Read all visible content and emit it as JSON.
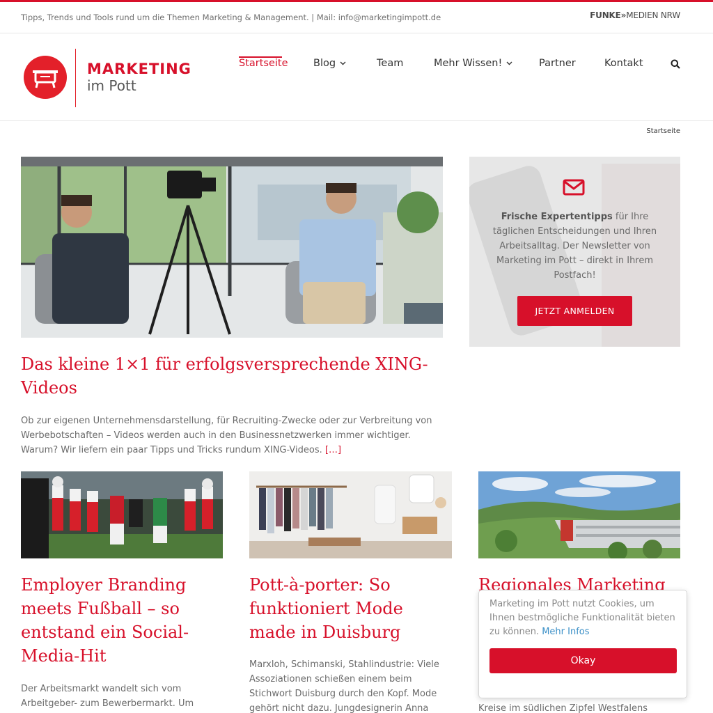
{
  "topbar": {
    "tagline": "Tipps, Trends und Tools rund um die Themen Marketing & Management. | Mail: info@marketingimpott.de",
    "brand_bold": "FUNKE",
    "brand_rest": "MEDIEN NRW"
  },
  "logo": {
    "line1": "MARKETING",
    "line2": "im Pott"
  },
  "nav": {
    "items": [
      {
        "label": "Startseite",
        "active": true
      },
      {
        "label": "Blog"
      },
      {
        "label": "Team"
      },
      {
        "label": "Mehr Wissen!"
      },
      {
        "label": "Partner"
      },
      {
        "label": "Kontakt"
      }
    ],
    "search_icon": "search-icon"
  },
  "breadcrumb": "Startseite",
  "featured": {
    "title": "Das kleine 1×1 für erfolgsversprechende XING-Videos",
    "excerpt": "Ob zur eigenen Unternehmensdarstellung, für Recruiting-Zwecke oder zur Verbreitung von Werbebotschaften – Videos werden auch in den Businessnetzwerken immer wichtiger. Warum? Wir liefern ein paar Tipps und Tricks rundum XING-Videos.",
    "more": "[…]"
  },
  "newsletter": {
    "icon": "envelope-icon",
    "bold": "Frische Expertentipps",
    "text": " für Ihre täglichen Entscheidungen und Ihren Arbeitsalltag. Der Newsletter von Marketing im Pott – direkt in Ihrem Postfach!",
    "button": "JETZT ANMELDEN"
  },
  "cards": [
    {
      "title": "Employer Branding meets Fußball – so entstand ein Social-Media-Hit",
      "excerpt": "Der Arbeitsmarkt wandelt sich vom Arbeitgeber- zum Bewerbermarkt. Um"
    },
    {
      "title": "Pott-à-porter: So funktioniert Mode made in Duisburg",
      "excerpt": "Marxloh, Schimanski, Stahlindustrie: Viele Assoziationen schießen einem beim Stichwort Duisburg durch den Kopf. Mode gehört nicht dazu. Jungdesignerin Anna Termöhlen"
    },
    {
      "title": "Regionales Marketing",
      "excerpt": "Kreise im südlichen Zipfel Westfalens stehen"
    }
  ],
  "cookie": {
    "text": "Marketing im Pott nutzt Cookies, um Ihnen bestmögliche Funktionalität bieten zu können.",
    "link": "Mehr Infos",
    "button": "Okay"
  },
  "colors": {
    "accent": "#d7102a",
    "link": "#3a8fc7"
  }
}
